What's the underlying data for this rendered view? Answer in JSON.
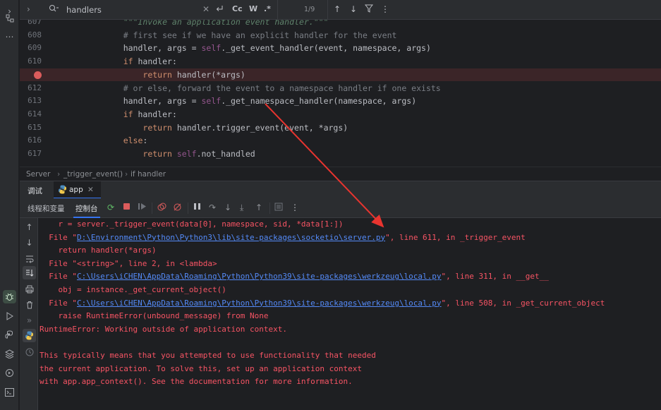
{
  "find": {
    "query": "handlers",
    "case_label": "Cc",
    "word_label": "W",
    "regex_label": ".*",
    "count": "1/9"
  },
  "editor": {
    "lines": [
      {
        "n": "607",
        "parts": [
          {
            "t": "    \"\"\"Invoke an application event handler.\"\"\"",
            "c": "doc"
          }
        ]
      },
      {
        "n": "608",
        "parts": [
          {
            "t": "    # first see if we have an explicit handler for the event",
            "c": "cm"
          }
        ]
      },
      {
        "n": "609",
        "parts": [
          {
            "t": "    handler, args = "
          },
          {
            "t": "self",
            "c": "slf"
          },
          {
            "t": "._get_event_handler(event, namespace, args)"
          }
        ]
      },
      {
        "n": "610",
        "parts": [
          {
            "t": "    "
          },
          {
            "t": "if",
            "c": "kw"
          },
          {
            "t": " handler:"
          }
        ]
      },
      {
        "n": "",
        "bp": true,
        "parts": [
          {
            "t": "        "
          },
          {
            "t": "return",
            "c": "kw"
          },
          {
            "t": " handler(*args)"
          }
        ]
      },
      {
        "n": "612",
        "parts": [
          {
            "t": "    # or else, forward the event to a namespace handler if one exists",
            "c": "cm"
          }
        ]
      },
      {
        "n": "613",
        "parts": [
          {
            "t": "    handler, args = "
          },
          {
            "t": "self",
            "c": "slf"
          },
          {
            "t": "._get_namespace_handler(namespace, args)"
          }
        ]
      },
      {
        "n": "614",
        "parts": [
          {
            "t": "    "
          },
          {
            "t": "if",
            "c": "kw"
          },
          {
            "t": " handler:"
          }
        ]
      },
      {
        "n": "615",
        "parts": [
          {
            "t": "        "
          },
          {
            "t": "return",
            "c": "kw"
          },
          {
            "t": " handler.trigger_event(event, *args)"
          }
        ]
      },
      {
        "n": "616",
        "parts": [
          {
            "t": "    "
          },
          {
            "t": "else",
            "c": "kw"
          },
          {
            "t": ":"
          }
        ]
      },
      {
        "n": "617",
        "parts": [
          {
            "t": "        "
          },
          {
            "t": "return",
            "c": "kw"
          },
          {
            "t": " "
          },
          {
            "t": "self",
            "c": "slf"
          },
          {
            "t": ".not_handled"
          }
        ]
      }
    ]
  },
  "breadcrumb": {
    "class_name": "Server",
    "method": "_trigger_event()",
    "block": "if handler"
  },
  "debug": {
    "title": "调试",
    "config": "app",
    "tab_threads": "线程和变量",
    "tab_console": "控制台"
  },
  "console": {
    "lines": [
      {
        "parts": [
          {
            "t": "    r = server._trigger_event(data[0], namespace, sid, *data[1:])"
          }
        ]
      },
      {
        "parts": [
          {
            "t": "  File \""
          },
          {
            "t": "D:\\Environment\\Python\\Python3\\lib\\site-packages\\socketio\\server.py",
            "link": true
          },
          {
            "t": "\", line 611, in _trigger_event"
          }
        ]
      },
      {
        "parts": [
          {
            "t": "    return handler(*args)"
          }
        ]
      },
      {
        "parts": [
          {
            "t": "  File \"<string>\", line 2, in <lambda>"
          }
        ]
      },
      {
        "parts": [
          {
            "t": "  File \""
          },
          {
            "t": "C:\\Users\\iCHEN\\AppData\\Roaming\\Python\\Python39\\site-packages\\werkzeug\\local.py",
            "link": true
          },
          {
            "t": "\", line 311, in __get__"
          }
        ]
      },
      {
        "parts": [
          {
            "t": "    obj = instance._get_current_object()"
          }
        ]
      },
      {
        "parts": [
          {
            "t": "  File \""
          },
          {
            "t": "C:\\Users\\iCHEN\\AppData\\Roaming\\Python\\Python39\\site-packages\\werkzeug\\local.py",
            "link": true
          },
          {
            "t": "\", line 508, in _get_current_object"
          }
        ]
      },
      {
        "parts": [
          {
            "t": "    raise RuntimeError(unbound_message) from None"
          }
        ]
      },
      {
        "parts": [
          {
            "t": "RuntimeError: Working outside of application context."
          }
        ]
      },
      {
        "parts": [
          {
            "t": ""
          }
        ]
      },
      {
        "parts": [
          {
            "t": "This typically means that you attempted to use functionality that needed"
          }
        ]
      },
      {
        "parts": [
          {
            "t": "the current application. To solve this, set up an application context"
          }
        ]
      },
      {
        "parts": [
          {
            "t": "with app.app_context(). See the documentation for more information."
          }
        ]
      }
    ]
  },
  "colors": {
    "background": "#1e1f22",
    "panel": "#2b2d30",
    "error_text": "#f75464",
    "link": "#548af7",
    "breakpoint": "#db5c5c",
    "annotation_arrow": "#e8342f"
  }
}
